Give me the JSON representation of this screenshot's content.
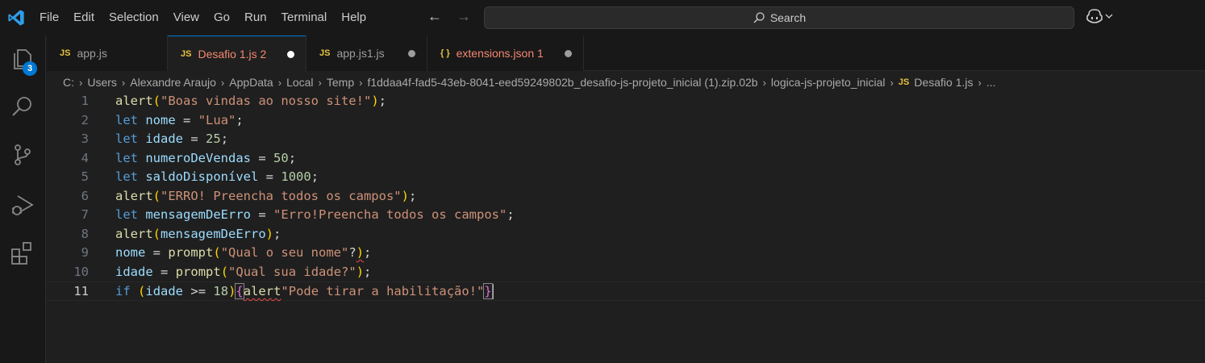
{
  "menu": [
    "File",
    "Edit",
    "Selection",
    "View",
    "Go",
    "Run",
    "Terminal",
    "Help"
  ],
  "search": {
    "label": "Search"
  },
  "activity": {
    "explorer_badge": "3"
  },
  "tabs": [
    {
      "icon": "JS",
      "label": "app.js",
      "dirty": false,
      "active": false,
      "error": false
    },
    {
      "icon": "JS",
      "label": "Desafio 1.js 2",
      "dirty": true,
      "active": true,
      "error": true
    },
    {
      "icon": "JS",
      "label": "app.js1.js",
      "dirty": true,
      "active": false,
      "error": false
    },
    {
      "icon": "{ }",
      "label": "extensions.json 1",
      "dirty": true,
      "active": false,
      "error": true
    }
  ],
  "breadcrumb": {
    "parts": [
      "C:",
      "Users",
      "Alexandre Araujo",
      "AppData",
      "Local",
      "Temp",
      "f1ddaa4f-fad5-43eb-8041-eed59249802b_desafio-js-projeto_inicial (1).zip.02b",
      "logica-js-projeto_inicial"
    ],
    "file_icon": "JS",
    "file": "Desafio 1.js",
    "more": "..."
  },
  "editor": {
    "line_numbers": [
      "1",
      "2",
      "3",
      "4",
      "5",
      "6",
      "7",
      "8",
      "9",
      "10",
      "11"
    ],
    "lines": [
      "alert(\"Boas vindas ao nosso site!\");",
      "let nome = \"Lua\";",
      "let idade = 25;",
      "let numeroDeVendas = 50;",
      "let saldoDisponível = 1000;",
      "alert(\"ERRO! Preencha todos os campos\");",
      "let mensagemDeErro = \"Erro!Preencha todos os campos\";",
      "alert(mensagemDeErro);",
      "nome = prompt(\"Qual o seu nome\"?);",
      "idade = prompt(\"Qual sua idade?\");",
      "if (idade >= 18){alert\"Pode tirar a habilitação!\"}"
    ],
    "current_line": 11
  },
  "colors": {
    "accent": "#0078d4",
    "error": "#f48771",
    "js": "#e8c33e"
  }
}
